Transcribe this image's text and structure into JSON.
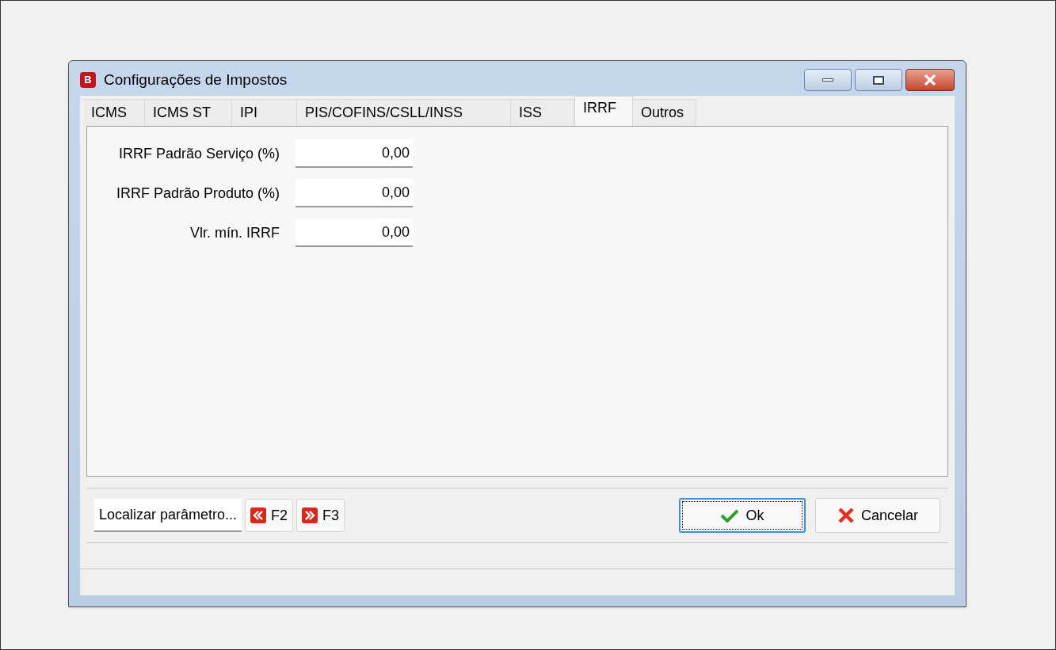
{
  "window": {
    "logo": "B",
    "title": "Configurações de Impostos"
  },
  "tabs": [
    {
      "label": "ICMS",
      "selected": false
    },
    {
      "label": "ICMS ST",
      "selected": false
    },
    {
      "label": "IPI",
      "selected": false
    },
    {
      "label": "PIS/COFINS/CSLL/INSS",
      "selected": false
    },
    {
      "label": "ISS",
      "selected": false
    },
    {
      "label": "IRRF",
      "selected": true
    },
    {
      "label": "Outros",
      "selected": false
    }
  ],
  "fields": [
    {
      "label": "IRRF Padrão Serviço (%)",
      "value": "0,00"
    },
    {
      "label": "IRRF Padrão Produto (%)",
      "value": "0,00"
    },
    {
      "label": "Vlr. mín. IRRF",
      "value": "0,00"
    }
  ],
  "footer": {
    "find_button": "Localizar parâmetro...",
    "prev_button": "F2",
    "next_button": "F3",
    "ok_button": "Ok",
    "cancel_button": "Cancelar"
  }
}
